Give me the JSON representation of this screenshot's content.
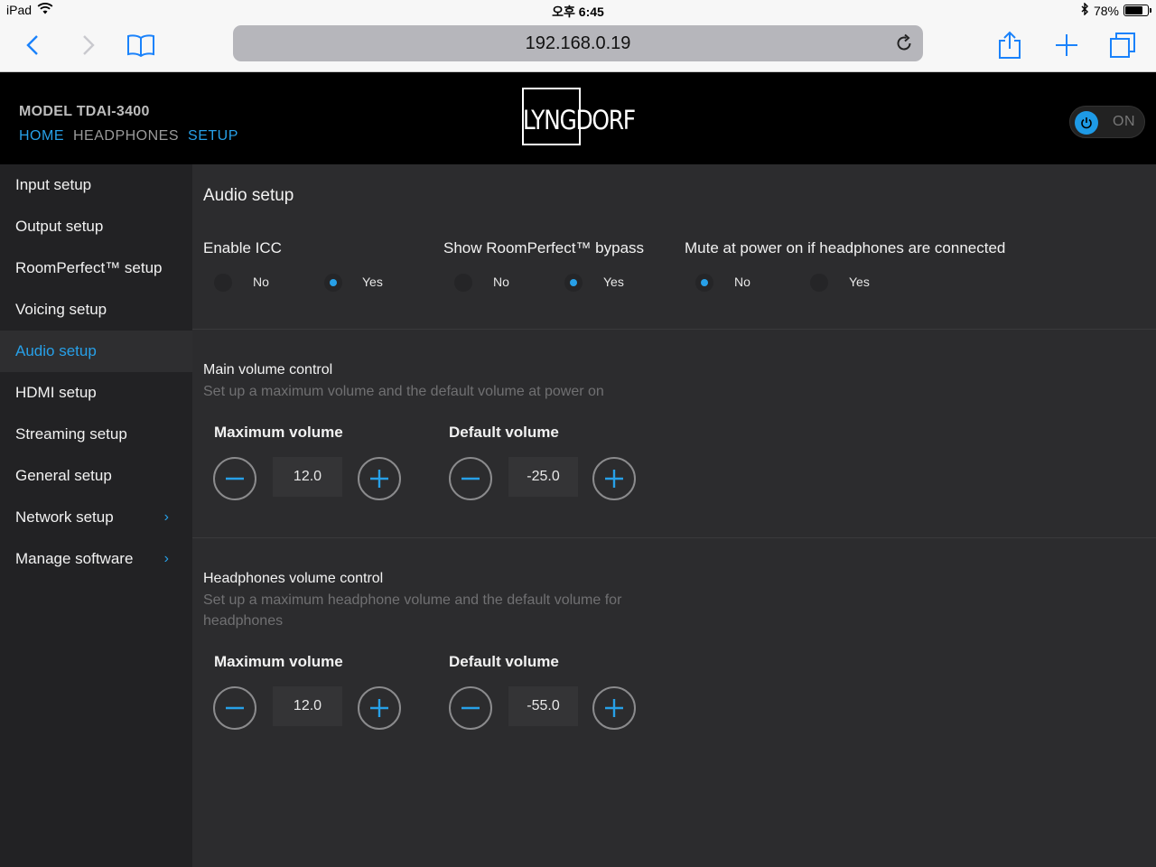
{
  "status": {
    "device": "iPad",
    "time": "오후 6:45",
    "battery": "78%",
    "battery_level": 0.78
  },
  "browser": {
    "url": "192.168.0.19"
  },
  "header": {
    "model": "MODEL TDAI-3400",
    "nav": {
      "home": "HOME",
      "headphones": "HEADPHONES",
      "setup": "SETUP"
    },
    "logo": "LYNGDORF",
    "power_label": "ON"
  },
  "sidebar": {
    "items": [
      {
        "label": "Input setup"
      },
      {
        "label": "Output setup"
      },
      {
        "label": "RoomPerfect™ setup"
      },
      {
        "label": "Voicing setup"
      },
      {
        "label": "Audio setup",
        "active": true
      },
      {
        "label": "HDMI setup"
      },
      {
        "label": "Streaming setup"
      },
      {
        "label": "General setup"
      },
      {
        "label": "Network setup",
        "chevron": "›"
      },
      {
        "label": "Manage software",
        "chevron": "›"
      }
    ]
  },
  "main": {
    "title": "Audio setup",
    "options": [
      {
        "label": "Enable ICC",
        "no": "No",
        "yes": "Yes",
        "selected": "Yes"
      },
      {
        "label": "Show RoomPerfect™ bypass",
        "no": "No",
        "yes": "Yes",
        "selected": "Yes"
      },
      {
        "label": "Mute at power on if headphones are connected",
        "no": "No",
        "yes": "Yes",
        "selected": "No"
      }
    ],
    "main_volume": {
      "heading": "Main volume control",
      "description": "Set up a maximum volume and the default volume at power on",
      "max_label": "Maximum volume",
      "max_value": "12.0",
      "default_label": "Default volume",
      "default_value": "-25.0"
    },
    "headphones_volume": {
      "heading": "Headphones volume control",
      "description": "Set up a maximum headphone volume and the default volume for headphones",
      "max_label": "Maximum volume",
      "max_value": "12.0",
      "default_label": "Default volume",
      "default_value": "-55.0"
    }
  },
  "colors": {
    "accent": "#27a0e8",
    "sidebar_bg": "#222224",
    "main_bg": "#2c2c2e",
    "header_bg": "#000000"
  }
}
